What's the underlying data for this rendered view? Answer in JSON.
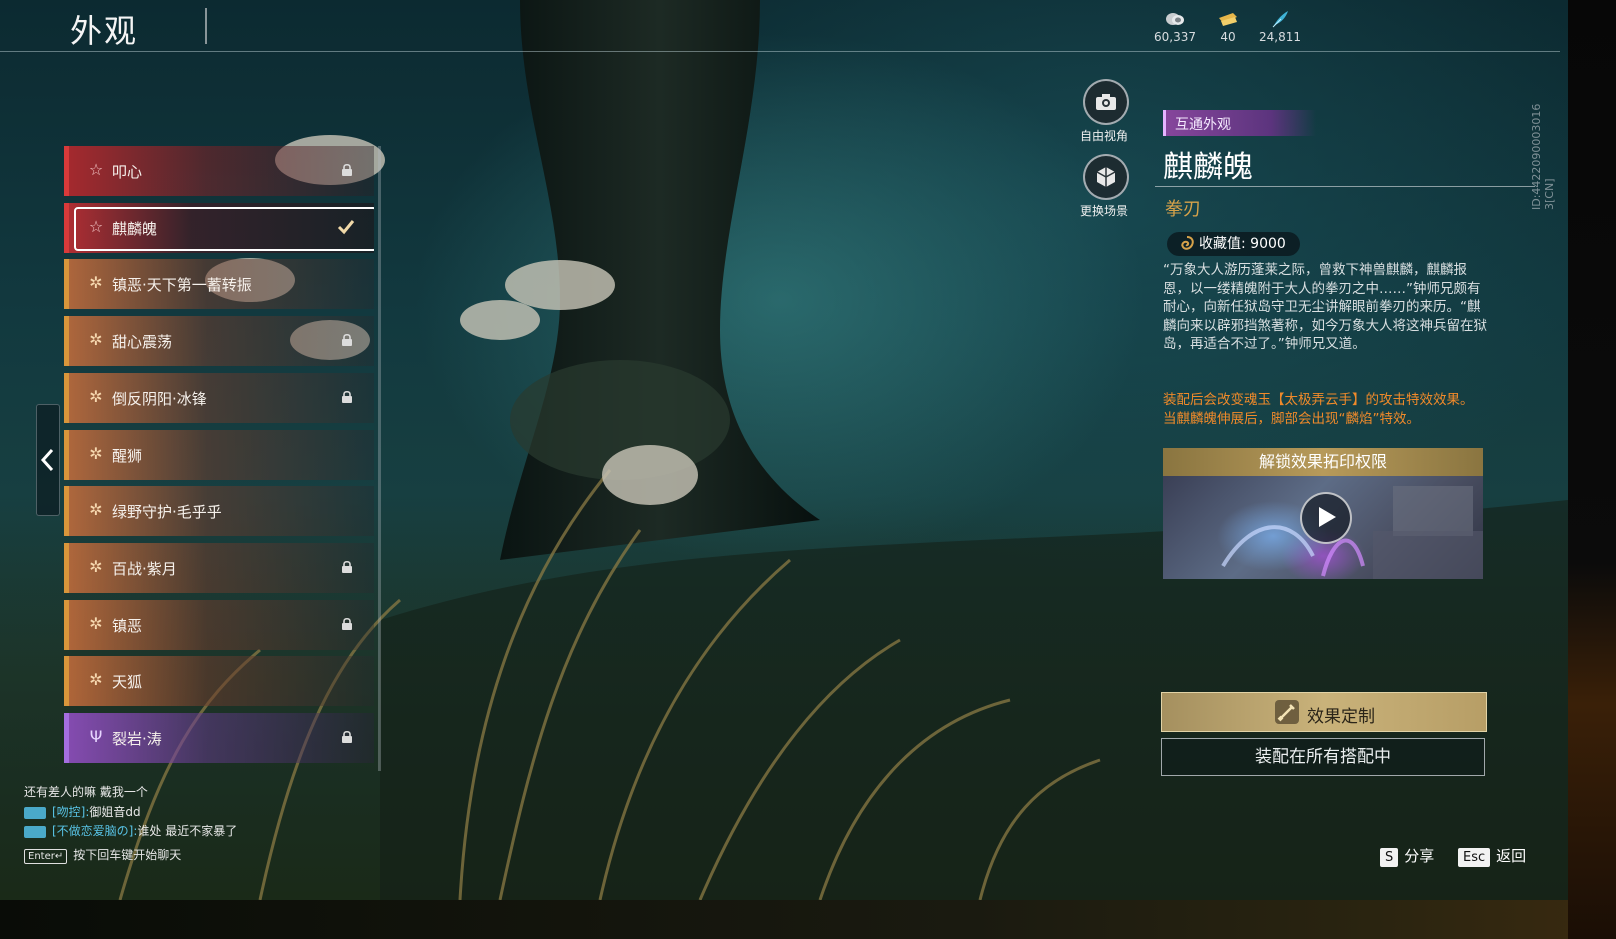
{
  "header": {
    "title": "外观",
    "currencies": [
      {
        "icon": "coin-stack-icon",
        "value": "60,337"
      },
      {
        "icon": "ticket-icon",
        "value": "40"
      },
      {
        "icon": "feather-icon",
        "value": "24,811"
      }
    ]
  },
  "skin_list": {
    "items": [
      {
        "label": "叩心",
        "rarity": "red",
        "icon": "star-icon",
        "locked": true,
        "selected": false
      },
      {
        "label": "麒麟魄",
        "rarity": "red",
        "icon": "star-icon",
        "locked": false,
        "selected": true
      },
      {
        "label": "镇恶·天下第一蓄转振",
        "rarity": "orange",
        "icon": "flower-icon",
        "locked": false,
        "selected": false
      },
      {
        "label": "甜心震荡",
        "rarity": "orange",
        "icon": "flower-icon",
        "locked": true,
        "selected": false
      },
      {
        "label": "倒反阴阳·冰锋",
        "rarity": "orange",
        "icon": "flower-icon",
        "locked": true,
        "selected": false
      },
      {
        "label": "醒狮",
        "rarity": "orange",
        "icon": "flower-icon",
        "locked": false,
        "selected": false
      },
      {
        "label": "绿野守护·毛乎乎",
        "rarity": "orange",
        "icon": "flower-icon",
        "locked": false,
        "selected": false
      },
      {
        "label": "百战·紫月",
        "rarity": "orange",
        "icon": "flower-icon",
        "locked": true,
        "selected": false
      },
      {
        "label": "镇恶",
        "rarity": "orange",
        "icon": "flower-icon",
        "locked": true,
        "selected": false
      },
      {
        "label": "天狐",
        "rarity": "orange",
        "icon": "flower-icon",
        "locked": false,
        "selected": false
      },
      {
        "label": "裂岩·涛",
        "rarity": "purple",
        "icon": "trident-icon",
        "locked": true,
        "selected": false
      }
    ]
  },
  "chat": {
    "line1": "还有差人的嘛 戴我一个",
    "line2_name": "[吻控]:",
    "line2_text": "御姐音dd",
    "line3_name": "[不做恋爱脑の]:",
    "line3_text": "谁处 最近不家暴了",
    "enter_key": "Enter↵",
    "hint": "按下回车键开始聊天"
  },
  "camera": {
    "free_view": "自由视角",
    "change_scene": "更换场景"
  },
  "detail": {
    "tag": "互通外观",
    "name": "麒麟魄",
    "type": "拳刃",
    "collect_label": "收藏值:",
    "collect_value": "9000",
    "description": "“万象大人游历蓬莱之际，曾救下神兽麒麟，麒麟报恩，以一缕精魄附于大人的拳刃之中……”钟师兄颇有耐心，向新任狱岛守卫无尘讲解眼前拳刃的来历。“麒麟向来以辟邪挡煞著称，如今万象大人将这神兵留在狱岛，再适合不过了。”钟师兄又道。",
    "effect": "装配后会改变魂玉【太极弄云手】的攻击特效效果。当麒麟魄伸展后，脚部会出现“麟焰”特效。",
    "unlock_title": "解锁效果拓印权限",
    "custom_button": "效果定制",
    "equip_button": "装配在所有搭配中"
  },
  "footer": {
    "share_key": "S",
    "share_label": "分享",
    "back_key": "Esc",
    "back_label": "返回"
  },
  "build_id": "ID:4422090003016 3[CN]",
  "colors": {
    "red_rarity": "#d83a3a",
    "orange_rarity": "#d9963b",
    "purple_rarity": "#a46ee0",
    "gold_accent": "#d6a24a",
    "effect_text": "#f08a2a",
    "tag_purple": "#8c46a0"
  }
}
